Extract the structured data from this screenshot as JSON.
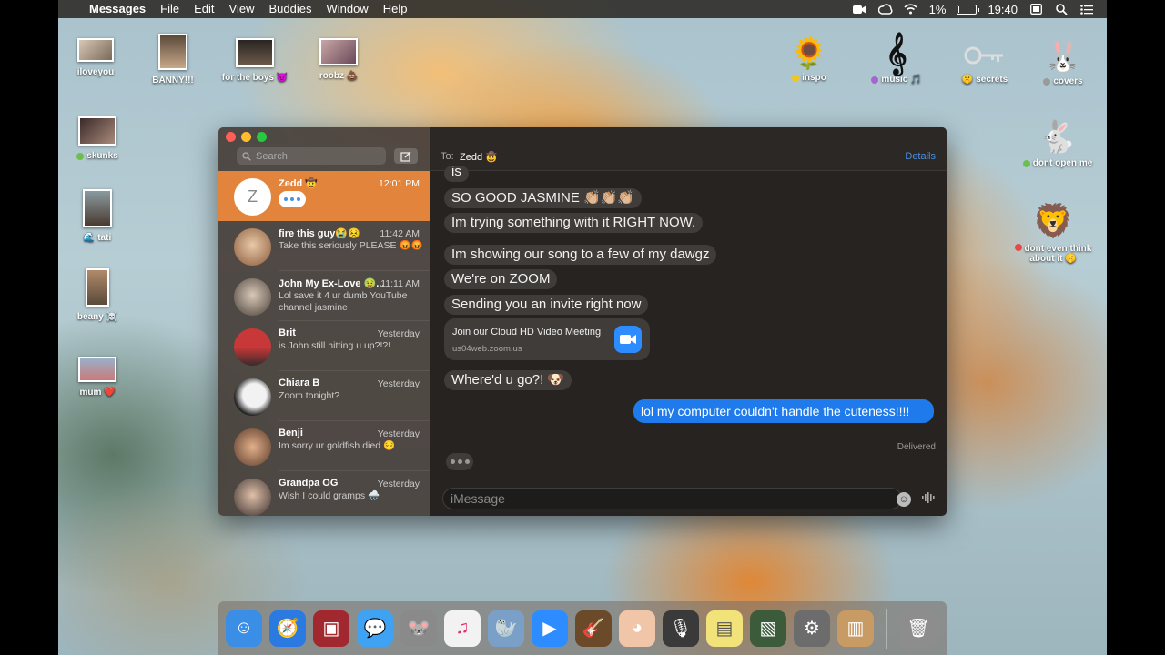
{
  "menubar": {
    "app": "Messages",
    "items": [
      "File",
      "Edit",
      "View",
      "Buddies",
      "Window",
      "Help"
    ],
    "battery_text": "1%",
    "battery_level": 0.01,
    "clock": "19:40"
  },
  "desktop": {
    "left_icons": [
      {
        "label": "iloveyou"
      },
      {
        "label": "BANNY!!!"
      },
      {
        "label": "for the boys 😈"
      },
      {
        "label": "roobz 💩"
      },
      {
        "label": "skunks",
        "tag": "#6bc04b"
      },
      {
        "label": "tati",
        "prefix": "🌊"
      },
      {
        "label": "beany ☠️"
      },
      {
        "label": "mum ❤️"
      }
    ],
    "right_icons": [
      {
        "label": "inspo",
        "tag": "#f5c518"
      },
      {
        "label": "music 🎵",
        "tag": "#a564d3"
      },
      {
        "label": "secrets",
        "prefix": "🤫"
      },
      {
        "label": "covers",
        "tag": "#9a9a9a"
      },
      {
        "label": "dont open me",
        "tag": "#6bc04b"
      },
      {
        "label": "dont even think about it 🤫",
        "tag": "#e8484a"
      }
    ]
  },
  "window": {
    "search_placeholder": "Search",
    "conversations": [
      {
        "name": "Zedd 🤠",
        "time": "12:01 PM",
        "preview": "",
        "initial": "Z",
        "active": true
      },
      {
        "name": "fire this guy😭😣",
        "time": "11:42 AM",
        "preview": "Take this seriously PLEASE 😡😡"
      },
      {
        "name": "John My Ex-Love 🤢...",
        "time": "11:11 AM",
        "preview": "Lol save it 4 ur dumb YouTube channel jasmine"
      },
      {
        "name": "Brit",
        "time": "Yesterday",
        "preview": "is John still hitting u up?!?!"
      },
      {
        "name": "Chiara B",
        "time": "Yesterday",
        "preview": "Zoom tonight?"
      },
      {
        "name": "Benji",
        "time": "Yesterday",
        "preview": "Im sorry ur goldfish died 😔"
      },
      {
        "name": "Grandpa OG",
        "time": "Yesterday",
        "preview": "Wish I could gramps 🌧️"
      }
    ],
    "chat": {
      "to_label": "To:",
      "to_name": "Zedd 🤠",
      "details": "Details",
      "messages": [
        "is",
        "SO GOOD JASMINE 👏🏼👏🏼👏🏼",
        "Im trying something with it RIGHT NOW.",
        "Im showing our song to a few of my dawgz",
        "We're on ZOOM",
        "Sending you an invite right now",
        "Where'd u go?! 🐶"
      ],
      "link_card": {
        "title": "Join our Cloud HD Video Meeting",
        "url": "us04web.zoom.us"
      },
      "sent": "lol my computer couldn't handle the cuteness!!!!",
      "status": "Delivered",
      "input_placeholder": "iMessage"
    }
  },
  "dock": {
    "items": [
      {
        "name": "finder",
        "color": "#3a8ee6"
      },
      {
        "name": "safari",
        "color": "#2a7ae2"
      },
      {
        "name": "photo-booth",
        "color": "#a0282e"
      },
      {
        "name": "messages",
        "color": "#3fa2f2"
      },
      {
        "name": "mouse-app",
        "color": "#8a8a8a"
      },
      {
        "name": "itunes",
        "color": "#f2f2f2"
      },
      {
        "name": "seal-app",
        "color": "#7aa0c8"
      },
      {
        "name": "zoom",
        "color": "#2d8cff"
      },
      {
        "name": "garageband",
        "color": "#6b4a2a"
      },
      {
        "name": "face-app",
        "color": "#f1c6a8"
      },
      {
        "name": "voice-memos",
        "color": "#3a3a3a"
      },
      {
        "name": "stickies",
        "color": "#f2e27a"
      },
      {
        "name": "preview",
        "color": "#3b5b3b"
      },
      {
        "name": "system-preferences",
        "color": "#6c6c6c"
      },
      {
        "name": "contacts",
        "color": "#c89a64"
      },
      {
        "name": "trash",
        "color": "#8d8d8d"
      }
    ]
  }
}
